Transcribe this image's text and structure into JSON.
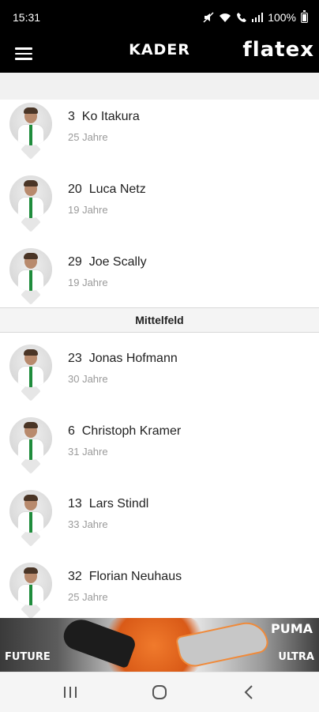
{
  "status_bar": {
    "time": "15:31",
    "battery": "100%"
  },
  "header": {
    "title": "KADER",
    "brand": "flatex"
  },
  "players_top": [
    {
      "number": "3",
      "name": "Ko Itakura",
      "age": "25 Jahre"
    },
    {
      "number": "20",
      "name": "Luca Netz",
      "age": "19 Jahre"
    },
    {
      "number": "29",
      "name": "Joe Scally",
      "age": "19 Jahre"
    }
  ],
  "section": {
    "title": "Mittelfeld"
  },
  "players_mid": [
    {
      "number": "23",
      "name": "Jonas Hofmann",
      "age": "30 Jahre"
    },
    {
      "number": "6",
      "name": "Christoph Kramer",
      "age": "31 Jahre"
    },
    {
      "number": "13",
      "name": "Lars Stindl",
      "age": "33 Jahre"
    },
    {
      "number": "32",
      "name": "Florian Neuhaus",
      "age": "25 Jahre"
    }
  ],
  "ad": {
    "left_text": "FUTURE",
    "right_text": "ULTRA",
    "brand": "PUMA"
  },
  "colors": {
    "header_bg": "#000000",
    "jersey_stripe": "#1f8c3c",
    "accent_orange": "#f07a2c"
  },
  "icons": [
    "menu-icon",
    "mute-icon",
    "wifi-icon",
    "call-icon",
    "signal-icon",
    "battery-icon",
    "recent-apps-icon",
    "home-icon",
    "back-icon"
  ]
}
